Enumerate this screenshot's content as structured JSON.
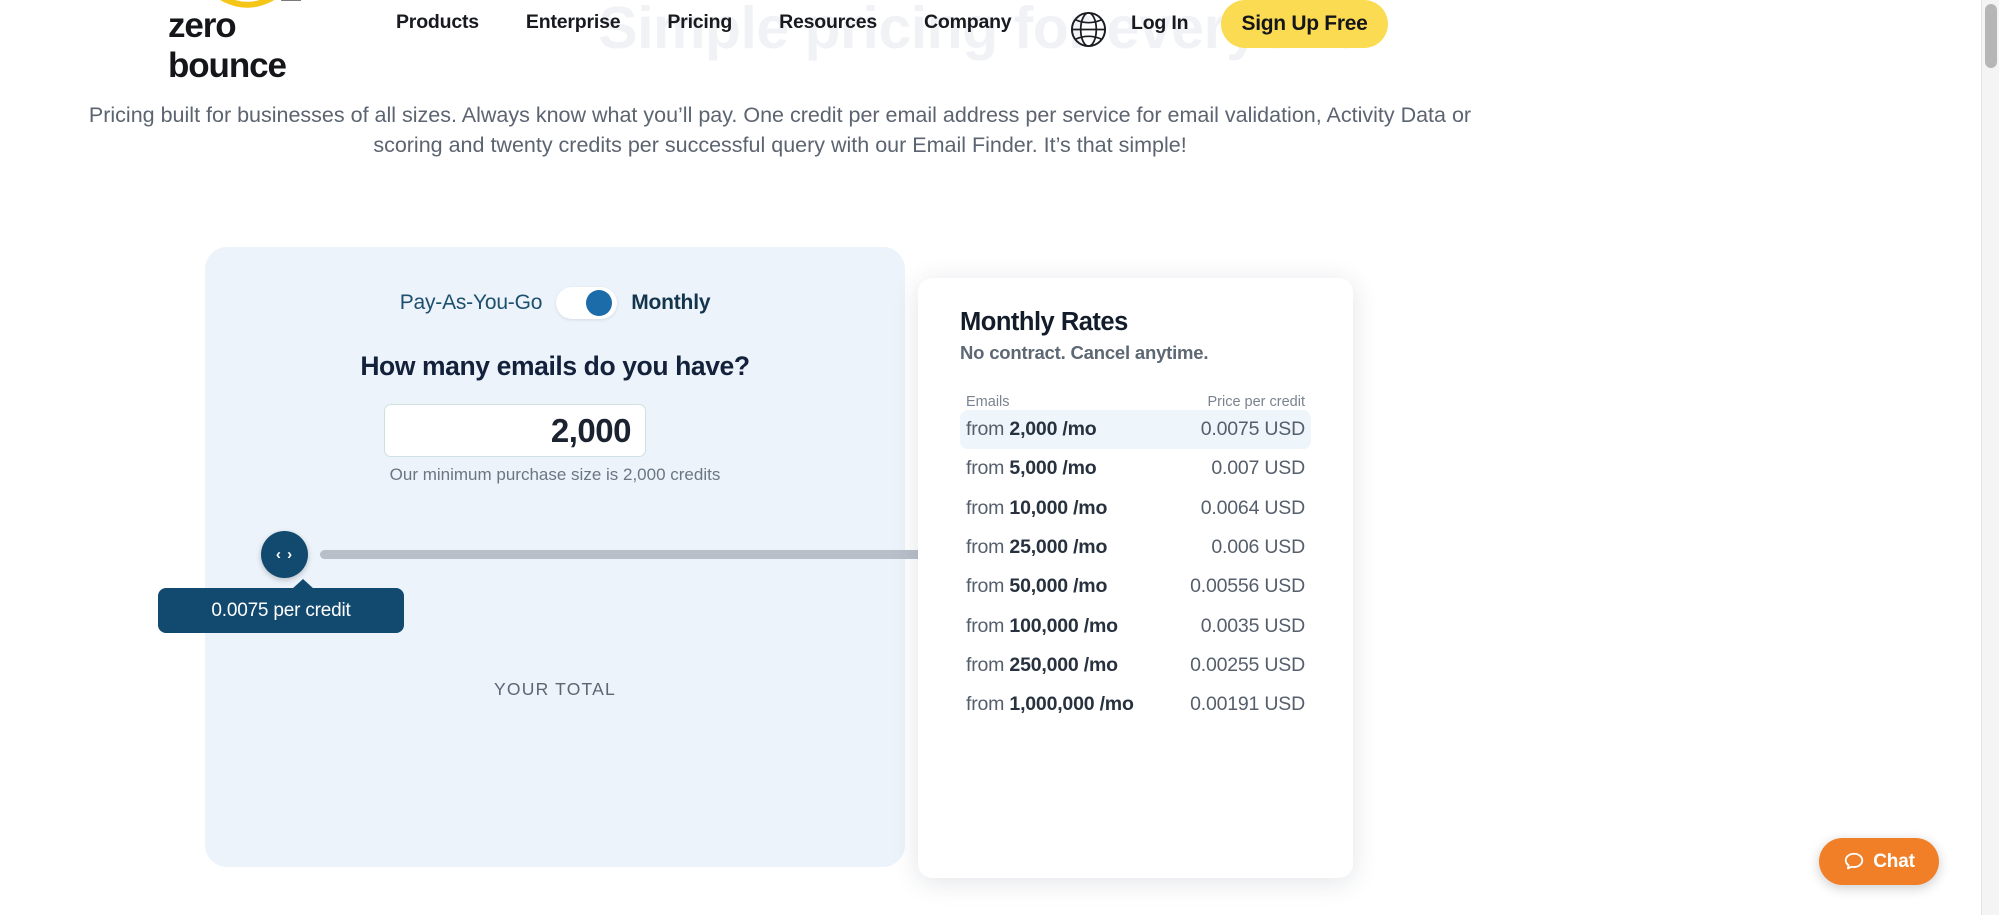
{
  "ghost_headline": "Simple pricing for everyone",
  "header": {
    "logo_text": "zero bounce",
    "nav_items": [
      {
        "label": "Products"
      },
      {
        "label": "Enterprise"
      },
      {
        "label": "Pricing"
      },
      {
        "label": "Resources"
      },
      {
        "label": "Company"
      }
    ],
    "globe_icon": "globe-icon",
    "login_label": "Log In",
    "signup_label": "Sign Up Free",
    "signup_color": "#fbdb52"
  },
  "description": "Pricing built for businesses of all sizes. Always know what you’ll pay. One credit per email address per service for email validation, Activity Data or scoring and twenty credits per successful query with our Email Finder. It’s that simple!",
  "calculator": {
    "toggle_left_label": "Pay-As-You-Go",
    "toggle_right_label": "Monthly",
    "toggle_state": "Monthly",
    "heading": "How many emails do you have?",
    "amount_value": "2,000",
    "amount_placeholder": "2,000",
    "min_note": "Our minimum purchase size is 2,000 credits",
    "slider_icon": "‹ ›",
    "tooltip_text": "0.0075 per credit",
    "total_label": "YOUR TOTAL",
    "accent_color": "#12496f",
    "card_bg": "#ecf3fb"
  },
  "rates": {
    "title": "Monthly Rates",
    "subtitle": "No contract. Cancel anytime.",
    "col_emails": "Emails",
    "col_price": "Price per credit",
    "rows": [
      {
        "prefix": "from",
        "emails": "2,000 /mo",
        "price": "0.0075 USD",
        "active": true
      },
      {
        "prefix": "from",
        "emails": "5,000 /mo",
        "price": "0.007 USD",
        "active": false
      },
      {
        "prefix": "from",
        "emails": "10,000 /mo",
        "price": "0.0064 USD",
        "active": false
      },
      {
        "prefix": "from",
        "emails": "25,000 /mo",
        "price": "0.006 USD",
        "active": false
      },
      {
        "prefix": "from",
        "emails": "50,000 /mo",
        "price": "0.00556 USD",
        "active": false
      },
      {
        "prefix": "from",
        "emails": "100,000 /mo",
        "price": "0.0035 USD",
        "active": false
      },
      {
        "prefix": "from",
        "emails": "250,000 /mo",
        "price": "0.00255 USD",
        "active": false
      },
      {
        "prefix": "from",
        "emails": "1,000,000 /mo",
        "price": "0.00191 USD",
        "active": false
      }
    ]
  },
  "chat": {
    "label": "Chat",
    "icon": "chat-bubble-icon",
    "color": "#f07f28"
  }
}
